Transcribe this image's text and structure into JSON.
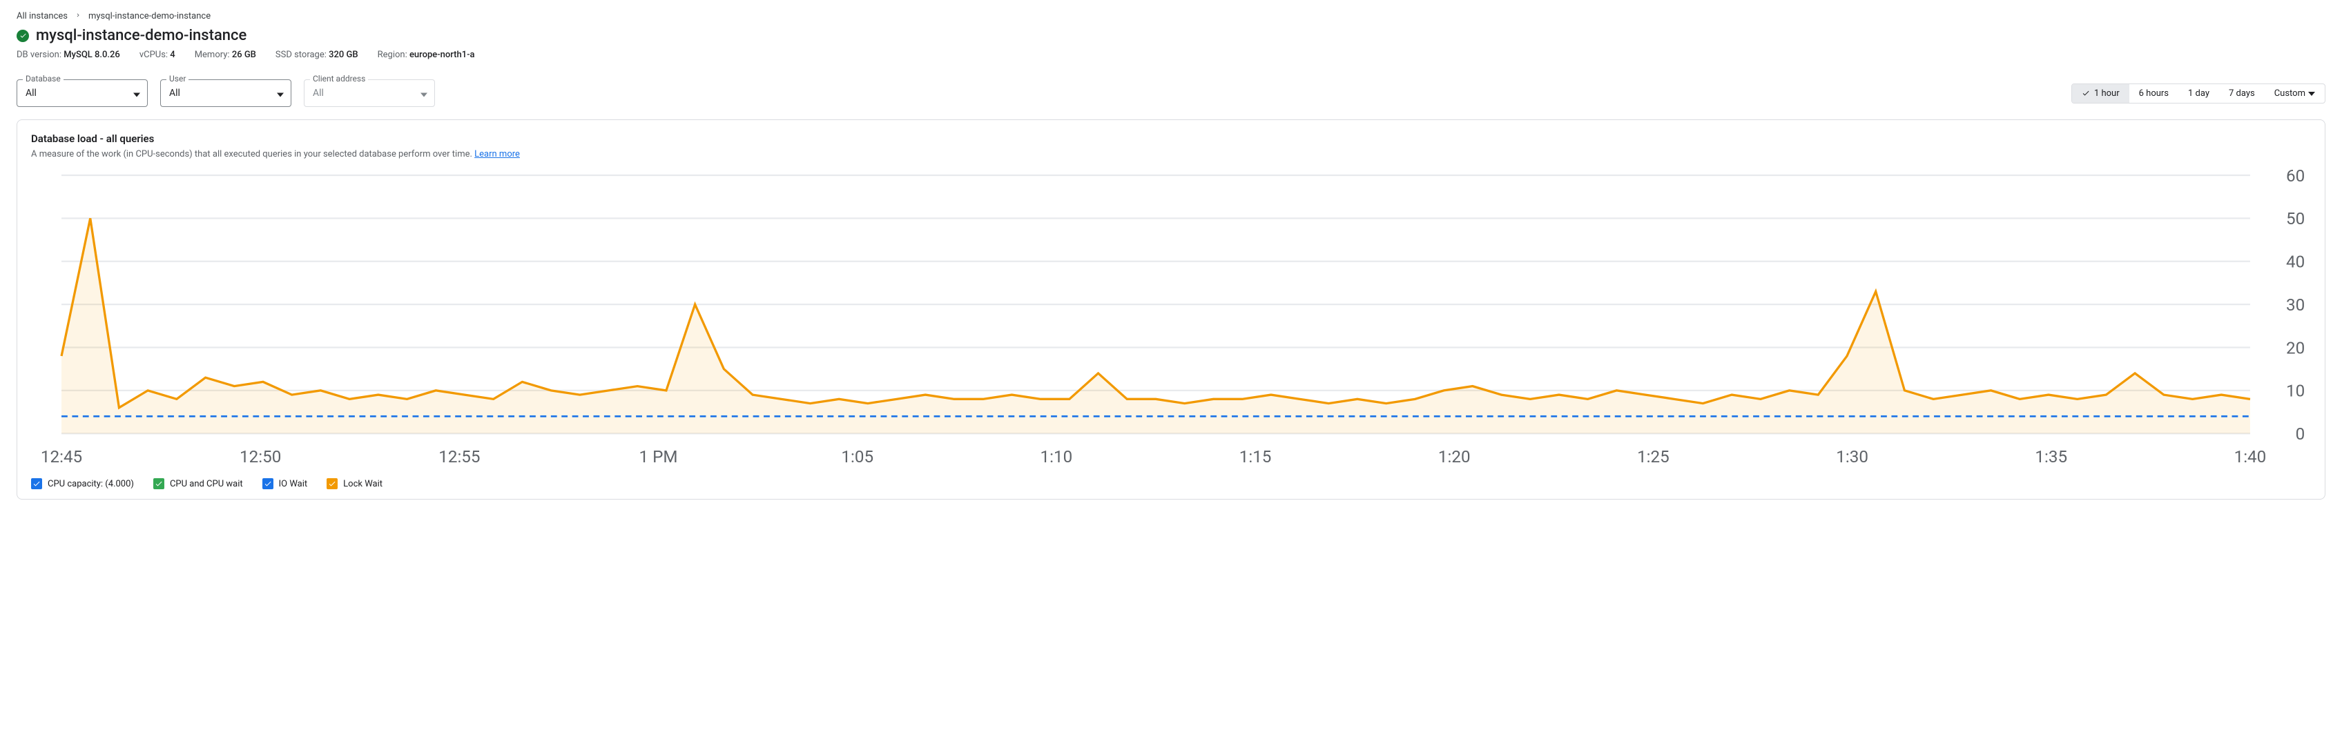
{
  "breadcrumb": {
    "root": "All instances",
    "current": "mysql-instance-demo-instance"
  },
  "title": "mysql-instance-demo-instance",
  "meta": {
    "db_label": "DB version:",
    "db_value": "MySQL 8.0.26",
    "vcpu_label": "vCPUs:",
    "vcpu_value": "4",
    "mem_label": "Memory:",
    "mem_value": "26 GB",
    "ssd_label": "SSD storage:",
    "ssd_value": "320 GB",
    "region_label": "Region:",
    "region_value": "europe-north1-a"
  },
  "filters": {
    "database": {
      "label": "Database",
      "value": "All"
    },
    "user": {
      "label": "User",
      "value": "All"
    },
    "client": {
      "label": "Client address",
      "value": "All"
    }
  },
  "time_range": {
    "options": [
      "1 hour",
      "6 hours",
      "1 day",
      "7 days",
      "Custom"
    ],
    "selected": "1 hour"
  },
  "card": {
    "title": "Database load - all queries",
    "subtitle": "A measure of the work (in CPU-seconds) that all executed queries in your selected database perform over time. ",
    "learn_more": "Learn more"
  },
  "legend": {
    "cpu_cap": {
      "label": "CPU capacity: (4.000)",
      "color": "#1a73e8"
    },
    "cpu_wait": {
      "label": "CPU and CPU wait",
      "color": "#34a853"
    },
    "io_wait": {
      "label": "IO Wait",
      "color": "#1a73e8"
    },
    "lock_wait": {
      "label": "Lock Wait",
      "color": "#f29900"
    }
  },
  "chart_data": {
    "type": "area",
    "ylim": [
      0,
      60
    ],
    "y_ticks": [
      0,
      10,
      20,
      30,
      40,
      50,
      60
    ],
    "cpu_capacity": 4.0,
    "x_ticks": [
      "12:45",
      "12:50",
      "12:55",
      "1 PM",
      "1:05",
      "1:10",
      "1:15",
      "1:20",
      "1:25",
      "1:30",
      "1:35",
      "1:40"
    ],
    "series": [
      {
        "name": "Lock Wait",
        "color": "#f29900",
        "values": [
          18,
          50,
          6,
          10,
          8,
          13,
          11,
          12,
          9,
          10,
          8,
          9,
          8,
          10,
          9,
          8,
          12,
          10,
          9,
          10,
          11,
          10,
          30,
          15,
          9,
          8,
          7,
          8,
          7,
          8,
          9,
          8,
          8,
          9,
          8,
          8,
          14,
          8,
          8,
          7,
          8,
          8,
          9,
          8,
          7,
          8,
          7,
          8,
          10,
          11,
          9,
          8,
          9,
          8,
          10,
          9,
          8,
          7,
          9,
          8,
          10,
          9,
          18,
          33,
          10,
          8,
          9,
          10,
          8,
          9,
          8,
          9,
          14,
          9,
          8,
          9,
          8
        ]
      },
      {
        "name": "CPU and CPU wait",
        "color": "#34a853",
        "values": [
          18,
          50,
          6,
          10,
          8,
          13,
          11,
          12,
          9,
          10,
          8,
          9,
          8,
          10,
          9,
          8,
          12,
          10,
          9,
          10,
          11,
          10,
          30,
          15,
          9,
          8,
          7,
          8,
          7,
          8,
          9,
          8,
          8,
          9,
          8,
          8,
          14,
          8,
          8,
          7,
          8,
          8,
          9,
          8,
          7,
          8,
          7,
          8,
          10,
          11,
          9,
          8,
          9,
          8,
          10,
          9,
          8,
          7,
          9,
          8,
          10,
          9,
          18,
          33,
          10,
          8,
          9,
          10,
          8,
          9,
          8,
          9,
          14,
          9,
          8,
          9,
          8
        ]
      }
    ]
  }
}
